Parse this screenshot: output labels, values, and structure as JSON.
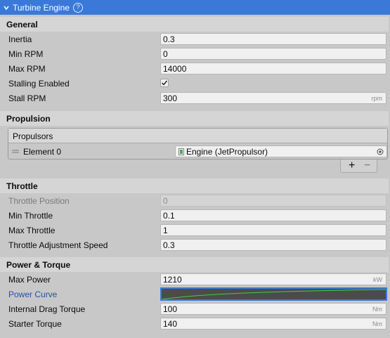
{
  "header": {
    "title": "Turbine Engine",
    "help_glyph": "?"
  },
  "sections": {
    "general": {
      "title": "General",
      "inertia": {
        "label": "Inertia",
        "value": "0.3"
      },
      "min_rpm": {
        "label": "Min RPM",
        "value": "0"
      },
      "max_rpm": {
        "label": "Max RPM",
        "value": "14000"
      },
      "stalling": {
        "label": "Stalling Enabled",
        "checked": true
      },
      "stall_rpm": {
        "label": "Stall RPM",
        "value": "300",
        "unit": "rpm"
      }
    },
    "propulsion": {
      "title": "Propulsion",
      "list_title": "Propulsors",
      "element_label": "Element 0",
      "element_value": "Engine (JetPropulsor)",
      "add_glyph": "+",
      "remove_glyph": "−"
    },
    "throttle": {
      "title": "Throttle",
      "position": {
        "label": "Throttle Position",
        "value": "0"
      },
      "min": {
        "label": "Min Throttle",
        "value": "0.1"
      },
      "max": {
        "label": "Max Throttle",
        "value": "1"
      },
      "speed": {
        "label": "Throttle Adjustment Speed",
        "value": "0.3"
      }
    },
    "power": {
      "title": "Power & Torque",
      "max_power": {
        "label": "Max Power",
        "value": "1210",
        "unit": "kW"
      },
      "curve": {
        "label": "Power Curve",
        "color": "#3cd23c"
      },
      "drag": {
        "label": "Internal Drag Torque",
        "value": "100",
        "unit": "Nm"
      },
      "starter": {
        "label": "Starter Torque",
        "value": "140",
        "unit": "Nm"
      }
    }
  },
  "colors": {
    "accent": "#3a79d8",
    "curve_bg": "#4b4b4b"
  }
}
